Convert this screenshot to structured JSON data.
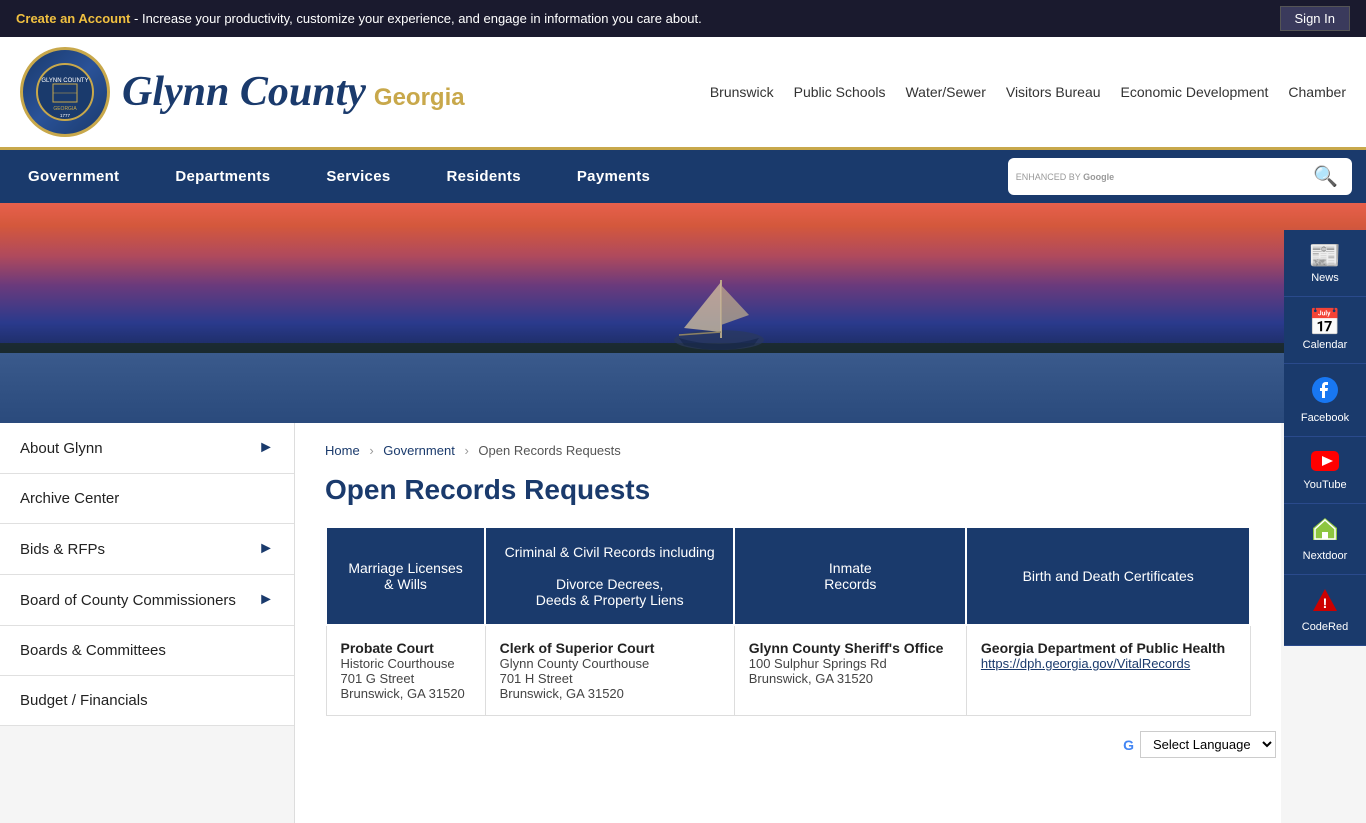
{
  "topbar": {
    "account_text": "Create an Account",
    "tagline": " - Increase your productivity, customize your experience, and engage in information you care about.",
    "sign_in_label": "Sign In"
  },
  "header": {
    "logo_alt": "Glynn County Georgia Seal",
    "site_title": "Glynn County",
    "site_subtitle": "Georgia",
    "links": [
      {
        "label": "Brunswick",
        "id": "brunswick"
      },
      {
        "label": "Public Schools",
        "id": "public-schools"
      },
      {
        "label": "Water/Sewer",
        "id": "water-sewer"
      },
      {
        "label": "Visitors Bureau",
        "id": "visitors-bureau"
      },
      {
        "label": "Economic Development",
        "id": "economic-development"
      },
      {
        "label": "Chamber",
        "id": "chamber"
      }
    ]
  },
  "nav": {
    "items": [
      {
        "label": "Government",
        "id": "government"
      },
      {
        "label": "Departments",
        "id": "departments"
      },
      {
        "label": "Services",
        "id": "services"
      },
      {
        "label": "Residents",
        "id": "residents"
      },
      {
        "label": "Payments",
        "id": "payments"
      }
    ],
    "search_placeholder": "enhanced by Google",
    "search_label": "ENHANCED BY Google"
  },
  "right_sidebar": {
    "items": [
      {
        "label": "News",
        "icon": "📰",
        "id": "news"
      },
      {
        "label": "Calendar",
        "icon": "📅",
        "id": "calendar"
      },
      {
        "label": "Facebook",
        "icon": "📘",
        "id": "facebook"
      },
      {
        "label": "YouTube",
        "icon": "▶",
        "id": "youtube"
      },
      {
        "label": "Nextdoor",
        "icon": "🏠",
        "id": "nextdoor"
      },
      {
        "label": "CodeRed",
        "icon": "⚠",
        "id": "codered"
      }
    ]
  },
  "left_sidebar": {
    "items": [
      {
        "label": "About Glynn",
        "has_arrow": true
      },
      {
        "label": "Archive Center",
        "has_arrow": false
      },
      {
        "label": "Bids & RFPs",
        "has_arrow": true
      },
      {
        "label": "Board of County Commissioners",
        "has_arrow": true
      },
      {
        "label": "Boards & Committees",
        "has_arrow": false
      },
      {
        "label": "Budget / Financials",
        "has_arrow": false
      }
    ]
  },
  "breadcrumb": {
    "home": "Home",
    "gov": "Government",
    "current": "Open Records Requests"
  },
  "content": {
    "page_title": "Open Records Requests",
    "table_headers": [
      "Marriage Licenses\n& Wills",
      "Criminal & Civil Records including\n\nDivorce Decrees,\nDeeds & Property Liens",
      "Inmate\nRecords",
      "Birth and Death Certificates"
    ],
    "departments": [
      {
        "name": "Probate Court",
        "location": "Historic Courthouse",
        "address": "701 G Street",
        "city": "Brunswick, GA 31520",
        "link": null
      },
      {
        "name": "Clerk of Superior Court",
        "location": "Glynn County Courthouse",
        "address": "701 H Street",
        "city": "Brunswick, GA 31520",
        "link": null
      },
      {
        "name": "Glynn County Sheriff's Office",
        "location": "",
        "address": "100 Sulphur Springs Rd",
        "city": "Brunswick, GA 31520",
        "link": null
      },
      {
        "name": "Georgia Department of Public Health",
        "location": "",
        "address": "",
        "city": "",
        "link": "https://dph.georgia.gov/VitalRecords"
      }
    ]
  },
  "translate": {
    "label": "Select Language"
  }
}
